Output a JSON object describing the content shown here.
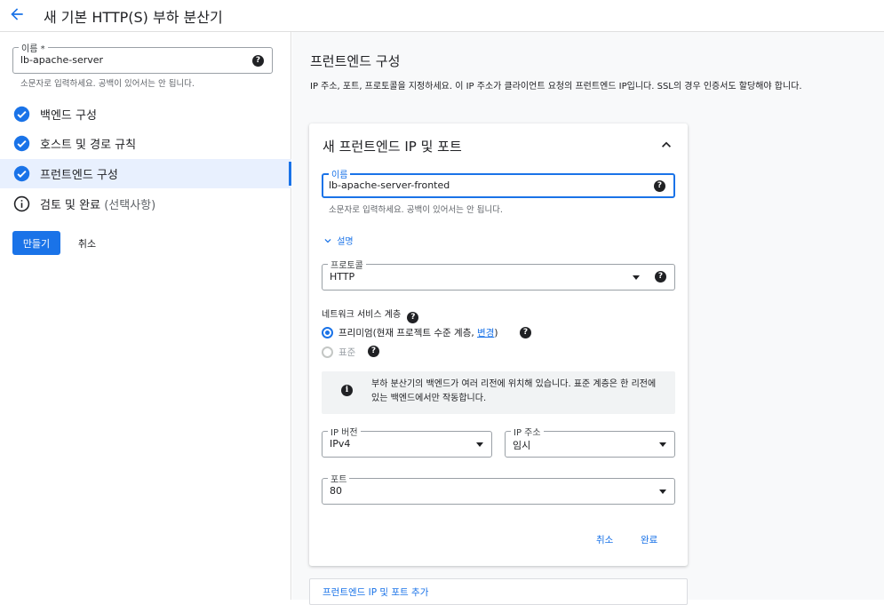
{
  "header": {
    "title": "새 기본 HTTP(S) 부하 분산기"
  },
  "sidebar": {
    "name_field": {
      "label": "이름 *",
      "value": "lb-apache-server",
      "hint": "소문자로 입력하세요. 공백이 있어서는 안 됩니다."
    },
    "steps": [
      {
        "label": "백엔드 구성",
        "status": "complete"
      },
      {
        "label": "호스트 및 경로 규칙",
        "status": "complete"
      },
      {
        "label": "프런트엔드 구성",
        "status": "complete",
        "active": true
      },
      {
        "label": "검토 및 완료",
        "optional": "(선택사항)",
        "status": "info"
      }
    ],
    "create_label": "만들기",
    "cancel_label": "취소"
  },
  "main": {
    "title": "프런트엔드 구성",
    "description": "IP 주소, 포트, 프로토콜을 지정하세요. 이 IP 주소가 클라이언트 요청의 프런트엔드 IP입니다. SSL의 경우 인증서도 할당해야 합니다.",
    "card": {
      "title": "새 프런트엔드 IP 및 포트",
      "name": {
        "label": "이름",
        "value": "lb-apache-server-fronted",
        "hint": "소문자로 입력하세요. 공백이 있어서는 안 됩니다."
      },
      "description_toggle": "설명",
      "protocol": {
        "label": "프로토콜",
        "value": "HTTP"
      },
      "network_tier": {
        "label": "네트워크 서비스 계층",
        "premium_label": "프리미엄(현재 프로젝트 수준 계층, ",
        "change_link": "변경",
        "premium_suffix": ")",
        "standard_label": "표준",
        "selected": "premium"
      },
      "info": "부하 분산기의 백엔드가 여러 리전에 위치해 있습니다. 표준 계층은 한 리전에 있는 백엔드에서만 작동합니다.",
      "ip_version": {
        "label": "IP 버전",
        "value": "IPv4"
      },
      "ip_address": {
        "label": "IP 주소",
        "value": "임시"
      },
      "port": {
        "label": "포트",
        "value": "80"
      },
      "cancel_label": "취소",
      "done_label": "완료"
    },
    "add_frontend_label": "프런트엔드 IP 및 포트 추가"
  },
  "colors": {
    "accent": "#1a73e8",
    "active_bg": "#e8f0fe"
  },
  "icons": {
    "back": "arrow-back-icon",
    "check": "check-circle-icon",
    "info": "info-outline-icon",
    "help": "help-icon",
    "expand_less": "chevron-up-icon",
    "expand_more": "chevron-down-icon",
    "dropdown": "dropdown-arrow-icon"
  }
}
